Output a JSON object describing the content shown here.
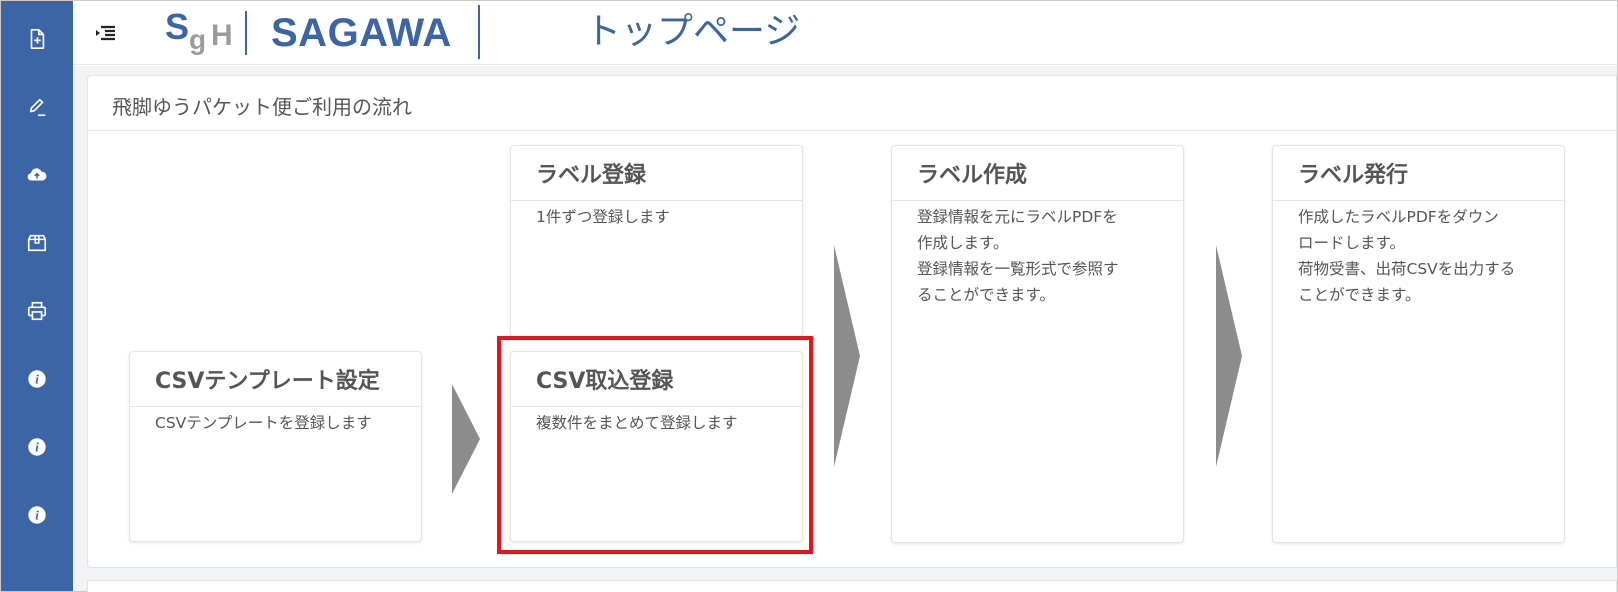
{
  "sidebar": {
    "color": "#3c65a8",
    "items": [
      {
        "icon": "file-add-icon"
      },
      {
        "icon": "edit-icon"
      },
      {
        "icon": "cloud-upload-icon"
      },
      {
        "icon": "package-icon"
      },
      {
        "icon": "printer-icon"
      },
      {
        "icon": "info-icon"
      },
      {
        "icon": "info-icon"
      },
      {
        "icon": "info-icon"
      }
    ]
  },
  "header": {
    "menu_icon": "menu-indent-icon",
    "logo_text": "SgH",
    "brand": "SAGAWA",
    "title": "トップページ"
  },
  "main": {
    "panel_title": "飛脚ゆうパケット便ご利用の流れ",
    "cards": {
      "csv_template": {
        "title": "CSVテンプレート設定",
        "lines": [
          "CSVテンプレートを登録します"
        ]
      },
      "label_register": {
        "title": "ラベル登録",
        "lines": [
          "1件ずつ登録します"
        ]
      },
      "csv_import": {
        "title": "CSV取込登録",
        "lines": [
          "複数件をまとめて登録します"
        ]
      },
      "label_create": {
        "title": "ラベル作成",
        "lines": [
          "登録情報を元にラベルPDFを",
          "作成します。",
          "登録情報を一覧形式で参照す",
          "ることができます。"
        ]
      },
      "label_issue": {
        "title": "ラベル発行",
        "lines": [
          "作成したラベルPDFをダウン",
          "ロードします。",
          "荷物受書、出荷CSVを出力する",
          "ことができます。"
        ]
      }
    },
    "highlight_color": "#e8131b",
    "arrow_color": "#8c8c8c"
  }
}
